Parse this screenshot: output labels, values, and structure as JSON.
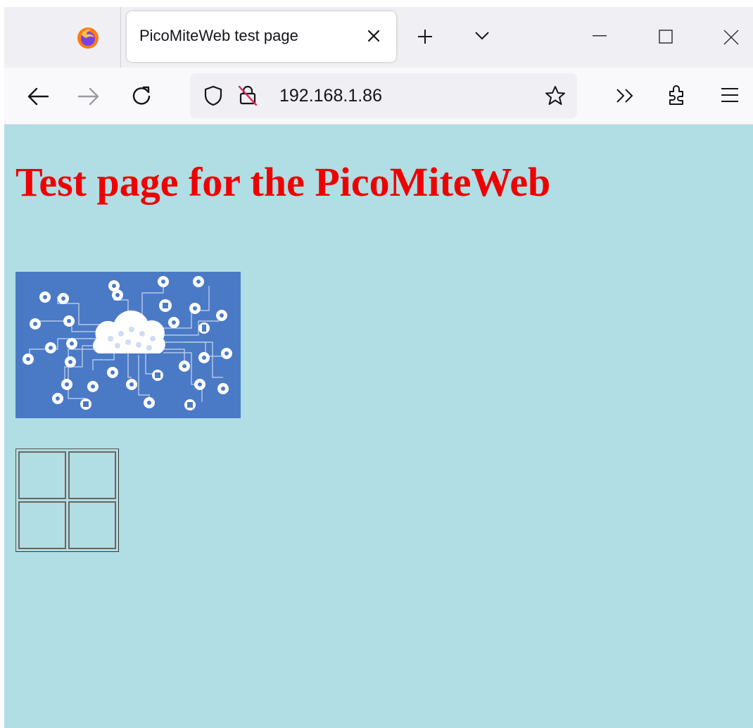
{
  "browser": {
    "tab": {
      "title": "PicoMiteWeb test page"
    },
    "url": "192.168.1.86"
  },
  "page": {
    "heading": "Test page for the PicoMiteWeb",
    "background_color": "#b0dee4",
    "heading_color": "#ee0000",
    "table": {
      "rows": 2,
      "cols": 2
    }
  },
  "icons": {
    "tabstrip": [
      "firefox-logo",
      "close-icon",
      "plus-icon",
      "chevron-down-icon",
      "minimize-icon",
      "maximize-icon",
      "window-close-icon"
    ],
    "navbar": [
      "back-arrow-icon",
      "forward-arrow-icon",
      "reload-icon",
      "shield-icon",
      "insecure-lock-icon",
      "star-icon",
      "overflow-chevrons-icon",
      "extensions-icon",
      "hamburger-menu-icon"
    ],
    "content": [
      "iot-cloud-network-image"
    ]
  }
}
